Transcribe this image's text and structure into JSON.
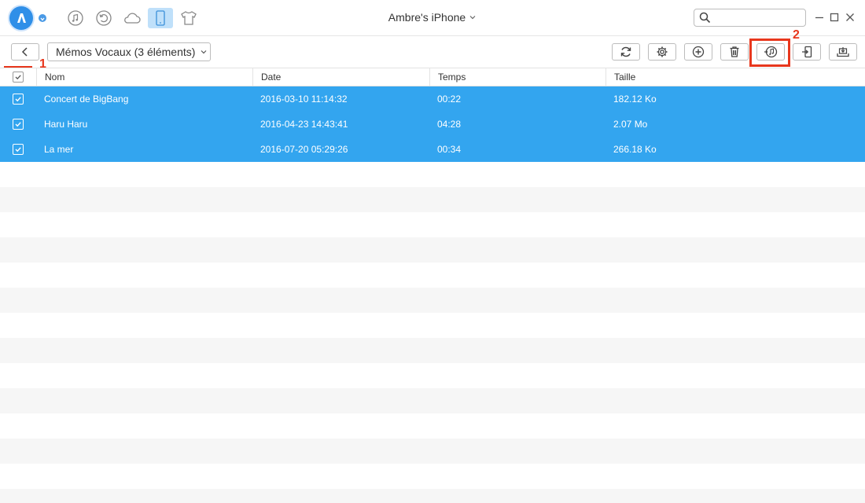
{
  "window": {
    "device_name": "Ambre's iPhone",
    "search": {
      "value": "",
      "placeholder": ""
    }
  },
  "nav": {
    "items": [
      {
        "name": "music-icon",
        "active": false
      },
      {
        "name": "history-icon",
        "active": false
      },
      {
        "name": "cloud-icon",
        "active": false
      },
      {
        "name": "phone-icon",
        "active": true
      },
      {
        "name": "tshirt-icon",
        "active": false
      }
    ]
  },
  "toolbar": {
    "category_label": "Mémos Vocaux (3 éléments)",
    "buttons": [
      "refresh-icon",
      "settings-icon",
      "add-icon",
      "delete-icon",
      "to-itunes-icon",
      "to-device-icon",
      "to-computer-icon"
    ]
  },
  "annotations": {
    "marker_1": "1",
    "marker_2": "2"
  },
  "table": {
    "headers": {
      "name": "Nom",
      "date": "Date",
      "duration": "Temps",
      "size": "Taille"
    },
    "rows": [
      {
        "name": "Concert de BigBang",
        "date": "2016-03-10 11:14:32",
        "duration": "00:22",
        "size": "182.12 Ko",
        "selected": true
      },
      {
        "name": "Haru Haru",
        "date": "2016-04-23 14:43:41",
        "duration": "04:28",
        "size": "2.07 Mo",
        "selected": true
      },
      {
        "name": "La mer",
        "date": "2016-07-20 05:29:26",
        "duration": "00:34",
        "size": "266.18 Ko",
        "selected": true
      }
    ]
  },
  "colors": {
    "accent": "#2f8fe8",
    "selection": "#33a5ef",
    "highlight": "#e8371d"
  }
}
